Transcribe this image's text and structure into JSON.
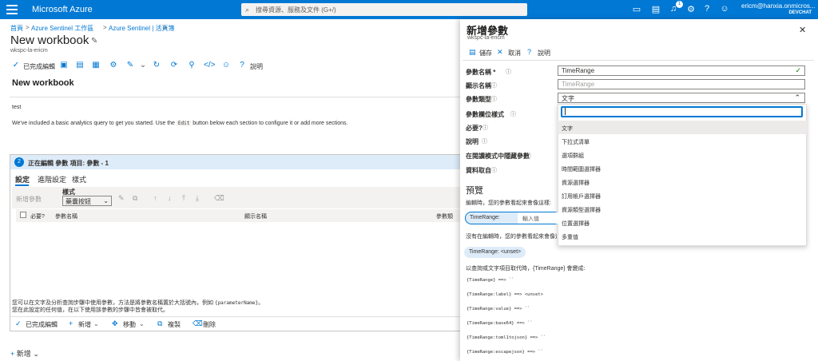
{
  "topbar": {
    "brand": "Microsoft Azure",
    "search_placeholder": "搜尋資源、服務及文件 (G+/)",
    "notification_count": "1",
    "user": "ericm@hanxia.onmicros...",
    "directory": "DEVCHAT"
  },
  "breadcrumb": {
    "items": [
      "首頁",
      "Azure Sentinel 工作區",
      "Azure Sentinel | 活頁簿"
    ],
    "separator": ">"
  },
  "page": {
    "title": "New workbook",
    "subtitle": "wkspc-la-ericm",
    "toolbar": {
      "done_label": "已完成編輯",
      "help_label": "說明"
    },
    "workbook_title": "New workbook",
    "test_text": "test",
    "intro_pre": "We've included a basic analytics query to get you started. Use the ",
    "intro_code": "Edit",
    "intro_post": " button below each section to configure it or add more sections."
  },
  "editor": {
    "step_number": "2",
    "heading": "正在編輯 參數 項目: 參數 - 1",
    "tabs": [
      "設定",
      "進階設定",
      "樣式"
    ],
    "add_param_label": "新增參數",
    "style_label": "樣式",
    "style_value": "藥囊按鈕",
    "columns": {
      "required": "必要?",
      "name": "參數名稱",
      "display": "顯示名稱",
      "type": "參數類"
    },
    "note1_pre": "您可以在文字及分析查詢步驟中使用參數，方法是將參數名稱置於大括號內，例如 ",
    "note1_code": "{parameterName}",
    "note1_post": "。",
    "note2": "您在此設定的任何值，在以下使用該參數的步驟中皆會被取代。",
    "bottom": {
      "done": "已完成編輯",
      "add": "新增",
      "move": "移動",
      "copy": "複製",
      "delete": "刪除"
    }
  },
  "bottom_add": "新增",
  "panel": {
    "title": "新增參數",
    "subtitle": "wkspc-la-ericm",
    "actions": {
      "save": "儲存",
      "cancel": "取消",
      "help": "說明"
    },
    "labels": {
      "name": "參數名稱 *",
      "display": "顯示名稱",
      "type": "參數類型",
      "field_style": "參數欄位樣式",
      "required": "必要?",
      "description": "說明",
      "hide_in_reading": "在閱讀模式中隱藏參數",
      "source": "資料取自"
    },
    "name_value": "TimeRange",
    "display_placeholder": "TimeRange",
    "type_value": "文字",
    "options": [
      "文字",
      "下拉式清單",
      "選項群組",
      "時間範圍選擇器",
      "資源選擇器",
      "訂用帳戶選擇器",
      "資源類型選擇器",
      "位置選擇器",
      "多重值"
    ],
    "preview": {
      "heading": "預覽",
      "editing_text": "編輯時，您的參數看起來會像這樣:",
      "param_label": "TimeRange:",
      "input_placeholder": "輸入值",
      "not_editing_text": "沒有在編輯時，您的參數看起來會像這",
      "unset_chip": "TimeRange: <unset>",
      "replace_text": "以查詢或文字項目取代時，{TimeRange} 會變成:",
      "mappings": [
        "{TimeRange} ==> ``",
        "{TimeRange:label} ==> <unset>",
        "{TimeRange:value} ==> ``",
        "{TimeRange:base64} ==> ``",
        "{TimeRange:toml1tojson} ==> ``",
        "{TimeRange:escapejson} ==> ``"
      ]
    }
  }
}
